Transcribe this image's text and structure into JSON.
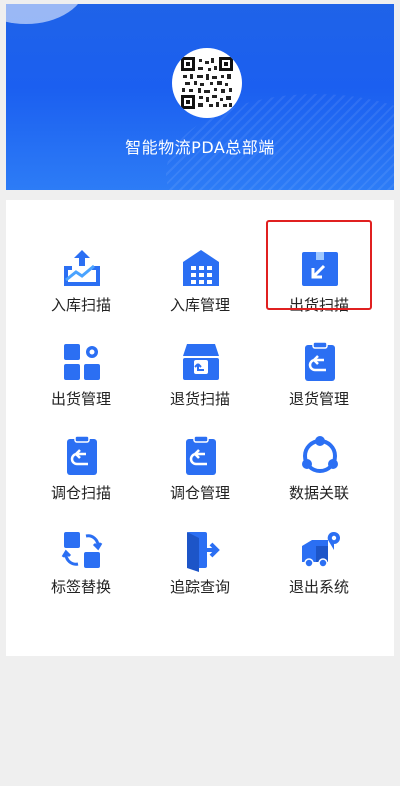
{
  "header": {
    "title": "智能物流PDA总部端",
    "qr_icon": "qr-code-icon"
  },
  "menu": [
    {
      "label": "入库扫描",
      "icon": "inbound-scan-icon"
    },
    {
      "label": "入库管理",
      "icon": "warehouse-icon"
    },
    {
      "label": "出货扫描",
      "icon": "outbound-scan-icon"
    },
    {
      "label": "出货管理",
      "icon": "outbound-manage-icon"
    },
    {
      "label": "退货扫描",
      "icon": "return-scan-icon"
    },
    {
      "label": "退货管理",
      "icon": "return-manage-icon"
    },
    {
      "label": "调仓扫描",
      "icon": "transfer-scan-icon"
    },
    {
      "label": "调仓管理",
      "icon": "transfer-manage-icon"
    },
    {
      "label": "数据关联",
      "icon": "data-link-icon"
    },
    {
      "label": "标签替换",
      "icon": "label-swap-icon"
    },
    {
      "label": "追踪查询",
      "icon": "track-query-icon"
    },
    {
      "label": "退出系统",
      "icon": "logout-truck-icon"
    }
  ],
  "colors": {
    "accent": "#1f63e8",
    "icon_blue": "#2b6ff3",
    "highlight": "#e02020"
  }
}
